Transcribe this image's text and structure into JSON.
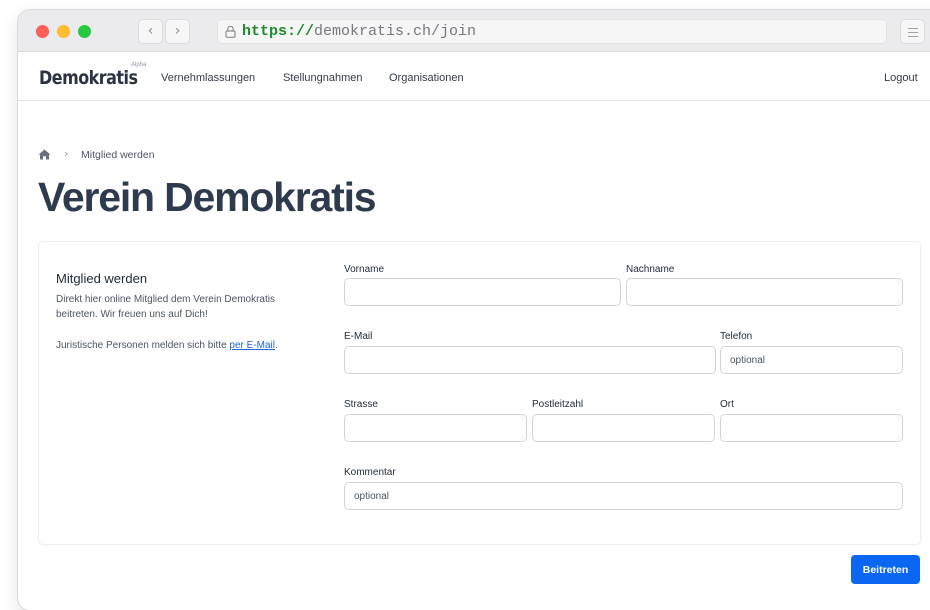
{
  "browser": {
    "url_scheme": "https://",
    "url_rest": "demokratis.ch/join",
    "back_glyph": "‹",
    "forward_glyph": "›",
    "icons": [
      "lock-icon",
      "menu-icon"
    ]
  },
  "site": {
    "brand": "Demokratis",
    "brand_badge": "Alpha",
    "nav": [
      "Vernehmlassungen",
      "Stellungnahmen",
      "Organisationen"
    ],
    "logout": "Logout"
  },
  "breadcrumb": {
    "home_icon": "home-icon",
    "separator": "›",
    "current": "Mitglied werden"
  },
  "page_title": "Verein Demokratis",
  "form_section": {
    "title": "Mitglied werden",
    "description": "Direkt hier online Mitglied dem Verein Demokratis beitreten. Wir freuen uns auf Dich!",
    "note_prefix": "Juristische Personen melden sich bitte ",
    "note_link": "per E-Mail",
    "note_suffix": "."
  },
  "fields": {
    "vorname": {
      "label": "Vorname",
      "value": "",
      "placeholder": ""
    },
    "nachname": {
      "label": "Nachname",
      "value": "",
      "placeholder": ""
    },
    "email": {
      "label": "E-Mail",
      "value": "",
      "placeholder": ""
    },
    "telefon": {
      "label": "Telefon",
      "value": "",
      "placeholder": "optional"
    },
    "strasse": {
      "label": "Strasse",
      "value": "",
      "placeholder": ""
    },
    "plz": {
      "label": "Postleitzahl",
      "value": "",
      "placeholder": ""
    },
    "ort": {
      "label": "Ort",
      "value": "",
      "placeholder": ""
    },
    "kommentar": {
      "label": "Kommentar",
      "value": "",
      "placeholder": "optional"
    }
  },
  "submit_label": "Beitreten",
  "colors": {
    "primary": "#0b67f2",
    "link": "#1d64e0",
    "title": "#2e3a4d",
    "url_scheme": "#1f8b2c"
  }
}
